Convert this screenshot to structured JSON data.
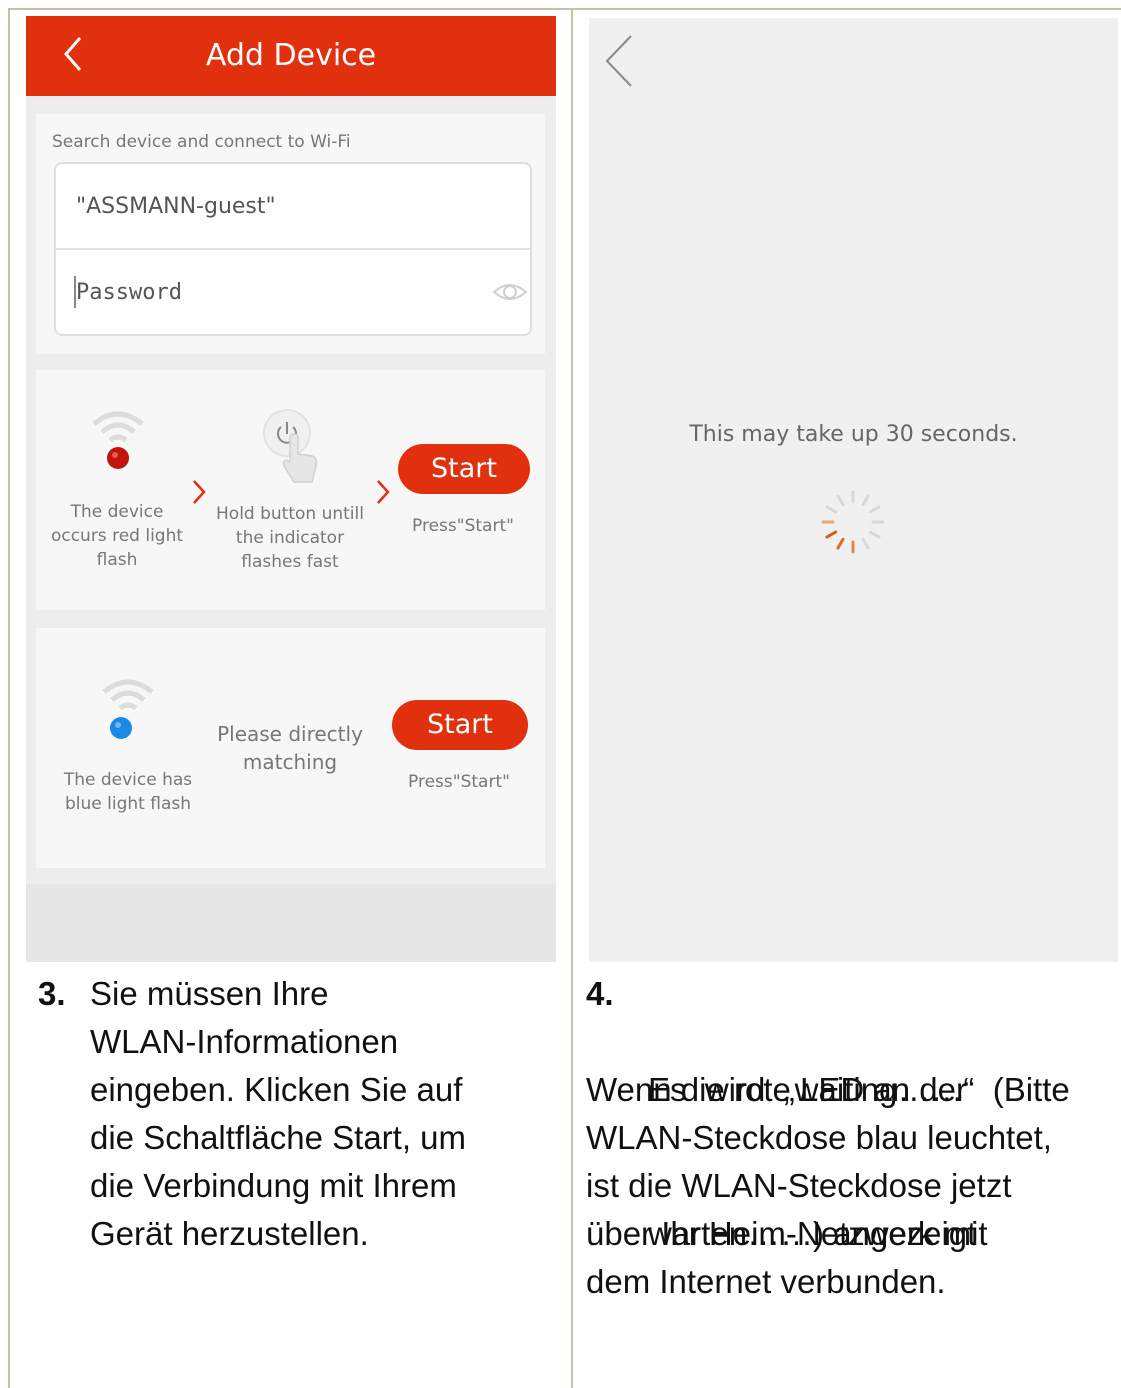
{
  "left": {
    "header": {
      "title": "Add Device"
    },
    "wifi": {
      "hint": "Search device and connect to Wi-Fi",
      "ssid": "\"ASSMANN-guest\"",
      "password_placeholder": "Password"
    },
    "red_mode": {
      "step1": [
        "The device",
        "occurs red light",
        "flash"
      ],
      "step2": [
        "Hold button untill",
        "the indicator",
        "flashes fast"
      ],
      "start_label": "Start",
      "press_label": "Press\"Start\""
    },
    "blue_mode": {
      "step1": [
        "The device has",
        "blue light flash"
      ],
      "step2": [
        "Please directly",
        "matching"
      ],
      "start_label": "Start",
      "press_label": "Press\"Start\""
    }
  },
  "right": {
    "wait_text": "This may take up 30 seconds."
  },
  "captions": {
    "left_num": "3.",
    "left_lines": [
      "Sie müssen Ihre",
      "WLAN-Informationen",
      "eingeben. Klicken Sie auf",
      "die Schaltfläche Start, um",
      "die Verbindung mit Ihrem",
      "Gerät herzustellen."
    ],
    "right_num": "4.",
    "right_lines": [
      "Es  wird  „waiting……“  (Bitte",
      "warten……) angezeigt",
      "Wenn die rote LED an der",
      "WLAN-Steckdose blau leuchtet,",
      "ist die WLAN-Steckdose jetzt",
      "über Ihr Heim-Netzwerk mit",
      "dem Internet verbunden."
    ]
  },
  "colors": {
    "accent": "#e0300d",
    "led_red": "#c0140c",
    "led_blue": "#1e88e5"
  },
  "icons": [
    "back-chevron-icon",
    "eye-icon",
    "wifi-icon",
    "red-led-icon",
    "power-button-icon",
    "hand-pointer-icon",
    "chevron-right-icon",
    "blue-led-icon",
    "loading-spinner-icon"
  ]
}
